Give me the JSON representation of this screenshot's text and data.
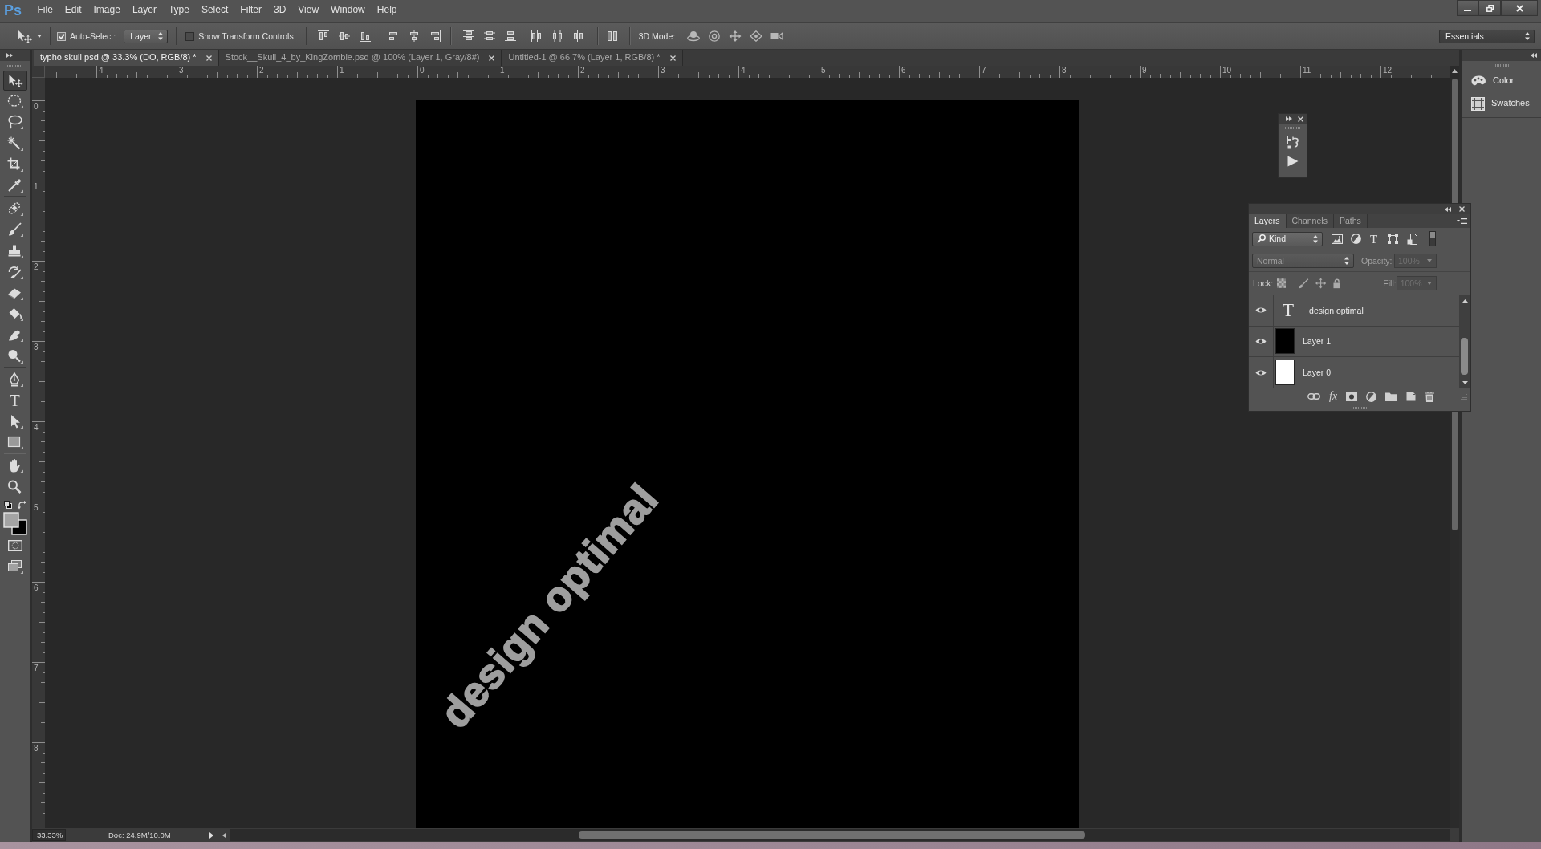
{
  "app_logo": "Ps",
  "menu": [
    "File",
    "Edit",
    "Image",
    "Layer",
    "Type",
    "Select",
    "Filter",
    "3D",
    "View",
    "Window",
    "Help"
  ],
  "options_bar": {
    "auto_select": {
      "label": "Auto-Select:",
      "checked": true
    },
    "auto_select_target": "Layer",
    "transform_controls": {
      "label": "Show Transform Controls",
      "checked": false
    },
    "mode_3d_label": "3D Mode:",
    "workspace": "Essentials"
  },
  "tool_groups": [
    {
      "tools": [
        {
          "kind": "move",
          "selected": true
        },
        {
          "kind": "marquee",
          "selected": false
        },
        {
          "kind": "lasso",
          "selected": false
        },
        {
          "kind": "magic_wand",
          "selected": false
        },
        {
          "kind": "crop",
          "selected": false
        },
        {
          "kind": "eyedropper",
          "selected": false
        }
      ]
    },
    {
      "tools": [
        {
          "kind": "healing",
          "selected": false
        },
        {
          "kind": "brush",
          "selected": false
        },
        {
          "kind": "stamp",
          "selected": false
        },
        {
          "kind": "history_brush",
          "selected": false
        },
        {
          "kind": "eraser",
          "selected": false
        },
        {
          "kind": "bucket",
          "selected": false
        },
        {
          "kind": "smudge",
          "selected": false
        },
        {
          "kind": "dodge",
          "selected": false
        }
      ]
    },
    {
      "tools": [
        {
          "kind": "pen",
          "selected": false
        },
        {
          "kind": "type",
          "glyph": "T",
          "selected": false
        },
        {
          "kind": "path_select",
          "selected": false
        },
        {
          "kind": "rectangle",
          "selected": false
        }
      ]
    },
    {
      "tools": [
        {
          "kind": "hand",
          "selected": false
        },
        {
          "kind": "zoom",
          "selected": false
        }
      ]
    }
  ],
  "color_swatches": [
    {
      "kind": "foreground",
      "color": "#a3a3a3"
    },
    {
      "kind": "background",
      "color": "#000000"
    }
  ],
  "document_tabs": [
    {
      "title": "typho skull.psd @ 33.3% (DO, RGB/8) *",
      "selected": true
    },
    {
      "title": "Stock__Skull_4_by_KingZombie.psd @ 100% (Layer 1, Gray/8#)",
      "selected": false
    },
    {
      "title": "Untitled-1 @ 66.7% (Layer 1, RGB/8) *",
      "selected": false
    }
  ],
  "rulers": {
    "horizontal": [
      "4",
      "3",
      "2",
      "1",
      "0",
      "1",
      "2",
      "3",
      "4",
      "5",
      "6",
      "7",
      "8",
      "9",
      "10",
      "11",
      "12"
    ],
    "vertical": [
      "0",
      "1",
      "2",
      "3",
      "4",
      "5",
      "6",
      "7",
      "8"
    ]
  },
  "document": {
    "text": "design optimal"
  },
  "layers_panel": {
    "tabs": [
      {
        "label": "Layers",
        "selected": true
      },
      {
        "label": "Channels",
        "selected": false
      },
      {
        "label": "Paths",
        "selected": false
      }
    ],
    "filter": {
      "label": "Kind",
      "type_filter": "T"
    },
    "blend_mode": {
      "value": "Normal",
      "disabled": true
    },
    "opacity": {
      "label": "Opacity:",
      "value": "100%",
      "disabled": true
    },
    "lock_label": "Lock:",
    "fill": {
      "label": "Fill:",
      "value": "100%",
      "disabled": true
    },
    "layers": [
      {
        "kind": "text",
        "glyph": "T",
        "name": "design optimal",
        "visible": true,
        "selected": false
      },
      {
        "kind": "pixel",
        "name": "Layer 1",
        "color": "#000000",
        "visible": true,
        "selected": false
      },
      {
        "kind": "pixel",
        "name": "Layer 0",
        "color": "#ffffff",
        "visible": true,
        "selected": false
      }
    ],
    "effects_button": "fx"
  },
  "dock": [
    {
      "kind": "color",
      "label": "Color"
    },
    {
      "kind": "swatches",
      "label": "Swatches"
    }
  ],
  "status_bar": {
    "zoom": "33.33%",
    "doc_size": "Doc: 24.9M/10.0M"
  }
}
